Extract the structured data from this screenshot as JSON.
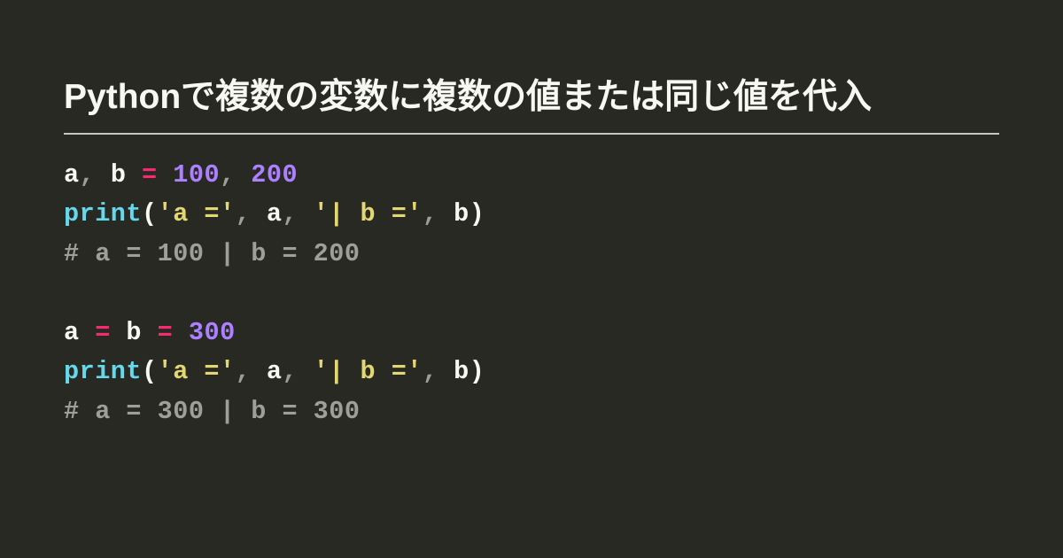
{
  "title": "Pythonで複数の変数に複数の値または同じ値を代入",
  "code": {
    "lines": [
      [
        {
          "t": "a",
          "c": "var"
        },
        {
          "t": ", ",
          "c": "punct"
        },
        {
          "t": "b ",
          "c": "var"
        },
        {
          "t": "=",
          "c": "op"
        },
        {
          "t": " ",
          "c": "var"
        },
        {
          "t": "100",
          "c": "num"
        },
        {
          "t": ", ",
          "c": "punct"
        },
        {
          "t": "200",
          "c": "num"
        }
      ],
      [
        {
          "t": "print",
          "c": "func"
        },
        {
          "t": "(",
          "c": "var"
        },
        {
          "t": "'a ='",
          "c": "str"
        },
        {
          "t": ", ",
          "c": "punct"
        },
        {
          "t": "a",
          "c": "var"
        },
        {
          "t": ", ",
          "c": "punct"
        },
        {
          "t": "'| b ='",
          "c": "str"
        },
        {
          "t": ", ",
          "c": "punct"
        },
        {
          "t": "b",
          "c": "var"
        },
        {
          "t": ")",
          "c": "var"
        }
      ],
      [
        {
          "t": "# a = 100 | b = 200",
          "c": "comment"
        }
      ],
      [],
      [
        {
          "t": "a ",
          "c": "var"
        },
        {
          "t": "=",
          "c": "op"
        },
        {
          "t": " b ",
          "c": "var"
        },
        {
          "t": "=",
          "c": "op"
        },
        {
          "t": " ",
          "c": "var"
        },
        {
          "t": "300",
          "c": "num"
        }
      ],
      [
        {
          "t": "print",
          "c": "func"
        },
        {
          "t": "(",
          "c": "var"
        },
        {
          "t": "'a ='",
          "c": "str"
        },
        {
          "t": ", ",
          "c": "punct"
        },
        {
          "t": "a",
          "c": "var"
        },
        {
          "t": ", ",
          "c": "punct"
        },
        {
          "t": "'| b ='",
          "c": "str"
        },
        {
          "t": ", ",
          "c": "punct"
        },
        {
          "t": "b",
          "c": "var"
        },
        {
          "t": ")",
          "c": "var"
        }
      ],
      [
        {
          "t": "# a = 300 | b = 300",
          "c": "comment"
        }
      ]
    ]
  }
}
